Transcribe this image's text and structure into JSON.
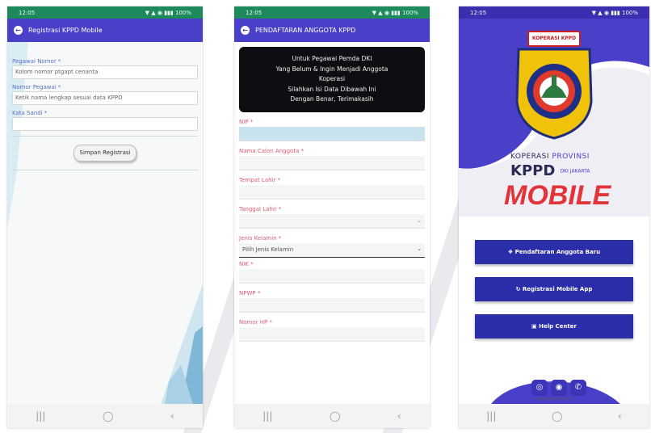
{
  "phone1": {
    "status_time": "12:05",
    "status_icons": "▼ ▲ ◉ ▮▮▮ 100%",
    "title": "Registrasi KPPD Mobile",
    "fields": [
      {
        "label": "Pegawai Nomor *",
        "value": "Kolom nomor ptgapt cenanta"
      },
      {
        "label": "Nomor Pegawai *",
        "value": "Ketik nama lengkap sesuai data KPPD"
      },
      {
        "label": "Kata Sandi *",
        "value": ""
      }
    ],
    "button": "Simpan Registrasi",
    "nav": [
      "|||",
      "◯",
      "‹"
    ]
  },
  "phone2": {
    "status_time": "12:05",
    "status_icons": "▼ ▲ ◉ ▮▮▮ 100%",
    "title": "PENDAFTARAN ANGGOTA KPPD",
    "banner_lines": [
      "Untuk Pegawai Pemda DKI",
      "Yang Belum & Ingin Menjadi Anggota",
      "Koperasi",
      "Silahkan Isi Data Dibawah Ini",
      "Dengan Benar, Terimakasih"
    ],
    "fields": [
      {
        "label": "NIP *",
        "value": ""
      },
      {
        "label": "Nama Calon Anggota *",
        "value": ""
      },
      {
        "label": "Tempat Lahir *",
        "value": ""
      },
      {
        "label": "Tanggal Lahir *",
        "value": ""
      },
      {
        "label": "Jenis Kelamin *",
        "value": "Pilih Jenis Kelamin"
      },
      {
        "label": "NIK *",
        "value": ""
      },
      {
        "label": "NPWP *",
        "value": ""
      },
      {
        "label": "Nomor HP *",
        "value": ""
      }
    ],
    "nav": [
      "|||",
      "◯",
      "‹"
    ]
  },
  "phone3": {
    "status_time": "12:05",
    "status_icons": "▼ ▲ ◉ ▮▮▮ 100%",
    "badge": "KOPERASI KPPD",
    "logo_line1": "KOPERASI",
    "logo_line1b": "PROVINSI",
    "logo_line2": "KPPD",
    "logo_line2b": "DKI JAKARTA",
    "logo_mobile": "MOBILE",
    "buttons": [
      "Pendaftaran Anggota Baru",
      "Registrasi Mobile App",
      "Help Center"
    ],
    "footer_text": "www.kppd-dki.com",
    "nav": [
      "|||",
      "◯",
      "‹"
    ]
  }
}
